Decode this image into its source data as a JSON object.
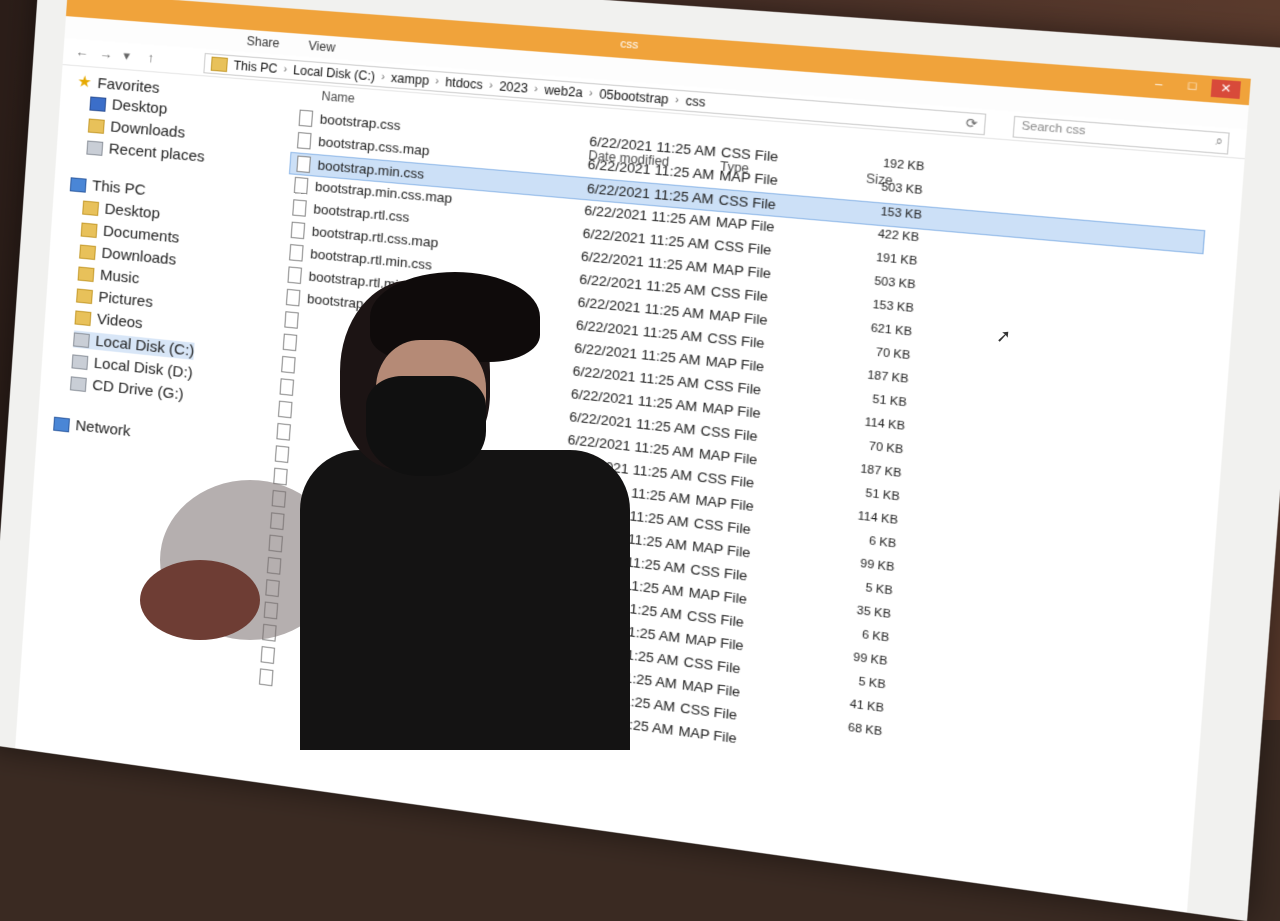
{
  "window": {
    "title": "css",
    "controls": {
      "minimize": "–",
      "maximize": "□",
      "close": "✕"
    }
  },
  "ribbon": {
    "tabs": [
      "Share",
      "View"
    ]
  },
  "nav": {
    "back_icon": "back-arrow-icon",
    "forward_icon": "forward-arrow-icon",
    "up_icon": "up-arrow-icon",
    "breadcrumb": [
      "This PC",
      "Local Disk (C:)",
      "xampp",
      "htdocs",
      "2023",
      "web2a",
      "05bootstrap",
      "css"
    ],
    "search_placeholder": "Search css"
  },
  "sidebar": {
    "favorites": {
      "label": "Favorites",
      "items": [
        "Desktop",
        "Downloads",
        "Recent places"
      ]
    },
    "this_pc": {
      "label": "This PC",
      "items": [
        "Desktop",
        "Documents",
        "Downloads",
        "Music",
        "Pictures",
        "Videos",
        "Local Disk (C:)",
        "Local Disk (D:)",
        "CD Drive (G:)"
      ]
    },
    "network": "Network"
  },
  "columns": {
    "name": "Name",
    "date": "Date modified",
    "type": "Type",
    "size": "Size"
  },
  "files": [
    {
      "name": "bootstrap.css",
      "date": "6/22/2021 11:25 AM",
      "type": "CSS File",
      "size": "192 KB"
    },
    {
      "name": "bootstrap.css.map",
      "date": "6/22/2021 11:25 AM",
      "type": "MAP File",
      "size": "503 KB"
    },
    {
      "name": "bootstrap.min.css",
      "date": "6/22/2021 11:25 AM",
      "type": "CSS File",
      "size": "153 KB",
      "selected": true
    },
    {
      "name": "bootstrap.min.css.map",
      "date": "6/22/2021 11:25 AM",
      "type": "MAP File",
      "size": "422 KB"
    },
    {
      "name": "bootstrap.rtl.css",
      "date": "6/22/2021 11:25 AM",
      "type": "CSS File",
      "size": "191 KB"
    },
    {
      "name": "bootstrap.rtl.css.map",
      "date": "6/22/2021 11:25 AM",
      "type": "MAP File",
      "size": "503 KB"
    },
    {
      "name": "bootstrap.rtl.min.css",
      "date": "6/22/2021 11:25 AM",
      "type": "CSS File",
      "size": "153 KB"
    },
    {
      "name": "bootstrap.rtl.min.css.map",
      "date": "6/22/2021 11:25 AM",
      "type": "MAP File",
      "size": "621 KB"
    },
    {
      "name": "bootstrap-grid.css",
      "date": "6/22/2021 11:25 AM",
      "type": "CSS File",
      "size": "70 KB"
    },
    {
      "name": "",
      "date": "6/22/2021 11:25 AM",
      "type": "MAP File",
      "size": "187 KB"
    },
    {
      "name": "",
      "date": "6/22/2021 11:25 AM",
      "type": "CSS File",
      "size": "51 KB"
    },
    {
      "name": "",
      "date": "6/22/2021 11:25 AM",
      "type": "MAP File",
      "size": "114 KB"
    },
    {
      "name": "",
      "date": "6/22/2021 11:25 AM",
      "type": "CSS File",
      "size": "70 KB"
    },
    {
      "name": "",
      "date": "6/22/2021 11:25 AM",
      "type": "MAP File",
      "size": "187 KB"
    },
    {
      "name": "",
      "date": "6/22/2021 11:25 AM",
      "type": "CSS File",
      "size": "51 KB"
    },
    {
      "name": "",
      "date": "6/22/2021 11:25 AM",
      "type": "MAP File",
      "size": "114 KB"
    },
    {
      "name": "",
      "date": "6/22/2021 11:25 AM",
      "type": "CSS File",
      "size": "6 KB"
    },
    {
      "name": "",
      "date": "6/22/2021 11:25 AM",
      "type": "MAP File",
      "size": "99 KB"
    },
    {
      "name": "",
      "date": "6/22/2021 11:25 AM",
      "type": "CSS File",
      "size": "5 KB"
    },
    {
      "name": "",
      "date": "6/22/2021 11:25 AM",
      "type": "MAP File",
      "size": "35 KB"
    },
    {
      "name": "",
      "date": "6/22/2021 11:25 AM",
      "type": "CSS File",
      "size": "6 KB"
    },
    {
      "name": "",
      "date": "6/22/2021 11:25 AM",
      "type": "MAP File",
      "size": "99 KB"
    },
    {
      "name": "",
      "date": "6/22/2021 11:25 AM",
      "type": "CSS File",
      "size": "5 KB"
    },
    {
      "name": "",
      "date": "6/22/2021 11:25 AM",
      "type": "MAP File",
      "size": "41 KB"
    },
    {
      "name": "",
      "date": "6/22/2021 11:25 AM",
      "type": "CSS File",
      "size": "68 KB"
    },
    {
      "name": "",
      "date": "6/22/2021 11:25 AM",
      "type": "MAP File",
      "size": ""
    }
  ],
  "colors": {
    "titlebar": "#f0a33b",
    "selection": "#cce0f7",
    "close": "#d84a3a"
  }
}
